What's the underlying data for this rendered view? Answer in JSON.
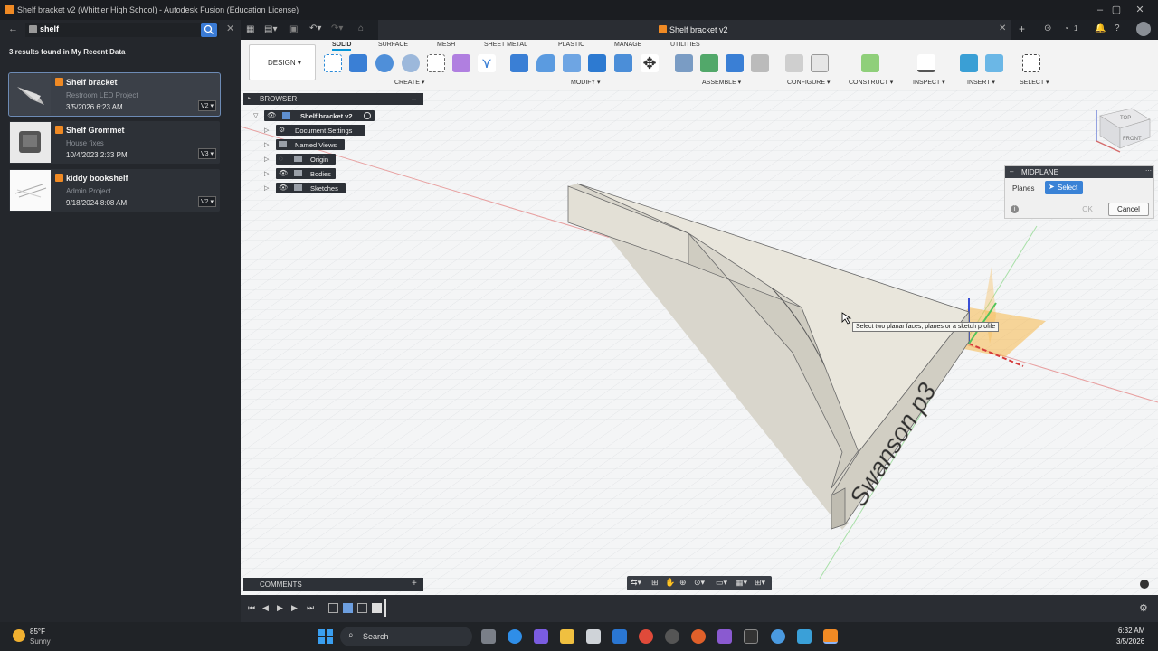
{
  "window": {
    "title": "Shelf bracket v2 (Whittier High School) - Autodesk Fusion (Education License)"
  },
  "search": {
    "query": "shelf",
    "results_summary": "3 results found in My Recent Data"
  },
  "results": [
    {
      "title": "Shelf bracket",
      "project": "Restroom LED Project",
      "date": "3/5/2026 6:23 AM",
      "version": "V2 ▾"
    },
    {
      "title": "Shelf Grommet",
      "project": "House fixes",
      "date": "10/4/2023 2:33 PM",
      "version": "V3 ▾"
    },
    {
      "title": "kiddy bookshelf",
      "project": "Admin Project",
      "date": "9/18/2024 8:08 AM",
      "version": "V2 ▾"
    }
  ],
  "doc_tab": {
    "label": "Shelf bracket v2",
    "count": "1"
  },
  "toolbar": {
    "workspace": "DESIGN ▾",
    "tabs": [
      "SOLID",
      "SURFACE",
      "MESH",
      "SHEET METAL",
      "PLASTIC",
      "MANAGE",
      "UTILITIES"
    ],
    "groups": [
      "CREATE ▾",
      "MODIFY ▾",
      "ASSEMBLE ▾",
      "CONFIGURE ▾",
      "CONSTRUCT ▾",
      "INSPECT ▾",
      "INSERT ▾",
      "SELECT ▾"
    ]
  },
  "browser": {
    "header": "BROWSER",
    "root": "Shelf bracket v2",
    "nodes": [
      "Document Settings",
      "Named Views",
      "Origin",
      "Bodies",
      "Sketches"
    ]
  },
  "viewcube": {
    "top": "TOP",
    "front": "FRONT"
  },
  "dialog": {
    "title": "MIDPLANE",
    "field_label": "Planes",
    "select_label": "Select",
    "ok_label": "OK",
    "cancel_label": "Cancel"
  },
  "tooltip": "Select two planar faces, planes or a sketch profile",
  "model_text": "Swanson p3",
  "comments": {
    "label": "COMMENTS",
    "add": "+"
  },
  "taskbar": {
    "weather_temp": "85°F",
    "weather_desc": "Sunny",
    "search_label": "Search",
    "time": "6:32 AM",
    "date": "3/5/2026"
  },
  "colors": {
    "accent": "#0696d7",
    "brand": "#f08a24",
    "plane": "#f7b84b"
  }
}
